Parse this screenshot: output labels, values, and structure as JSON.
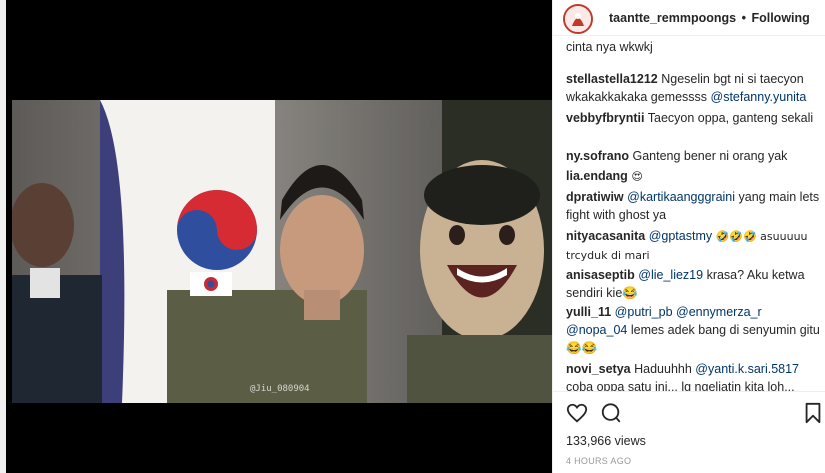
{
  "post": {
    "username": "taantte_remmpoongs",
    "separator": "•",
    "follow_status": "Following",
    "views": "133,966 views",
    "timestamp": "4 HOURS AGO"
  },
  "video": {
    "watermark": "@Jiu_080904"
  },
  "comments": [
    {
      "user": "",
      "text": "cinta nya wkwkj",
      "mention": ""
    },
    {
      "user": "stellastella1212",
      "text": "Ngeselin bgt ni si taecyon wkakakkakaka gemessss",
      "mention": "@stefanny.yunita"
    },
    {
      "user": "vebbyfbryntii",
      "text": "Taecyon oppa, ganteng sekali",
      "mention": ""
    },
    {
      "user": "ny.sofrano",
      "text": "Ganteng bener ni orang yak",
      "mention": ""
    },
    {
      "user": "lia.endang",
      "text": "😍",
      "mention": ""
    },
    {
      "user": "dpratiwiw",
      "mention": "@kartikaangggraini",
      "text": "yang main lets fight with ghost ya"
    },
    {
      "user": "nityacasanita",
      "mention": "@gptastmy",
      "text": "🤣🤣🤣 asuuuuu trcyduk di mari"
    },
    {
      "user": "anisaseptib",
      "mention": "@lie_liez19",
      "text": "krasa? Aku ketwa sendiri kie😂"
    },
    {
      "user": "yulli_11",
      "mention": "@putri_pb @ennymerza_r @nopa_04",
      "text": "lemes adek bang di senyumin gitu 😂😂"
    },
    {
      "user": "novi_setya",
      "text": "Haduuhhh",
      "mention": "@yanti.k.sari.5817",
      "text2": "coba oppa satu ini... lg ngeliatin kita loh..."
    }
  ],
  "actions": {
    "like_icon": "heart-icon",
    "comment_icon": "comment-icon",
    "save_icon": "bookmark-icon"
  },
  "colors": {
    "mention": "#003569",
    "timestamp": "#999999",
    "avatar_ring": "#c0392b"
  }
}
